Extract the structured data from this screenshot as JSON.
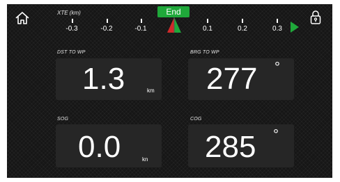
{
  "header": {
    "xte_label": "XTE (km)",
    "end_label": "End",
    "scale_ticks": [
      "-0.3",
      "-0.2",
      "-0.1",
      "0.1",
      "0.2",
      "0.3"
    ]
  },
  "icons": {
    "home": "home-icon",
    "lock": "padlock-icon",
    "boat": "boat-marker-icon",
    "direction": "play-arrow-icon"
  },
  "colors": {
    "accent_green": "#1fa83a",
    "marker_red": "#d12a2a",
    "background": "#161616",
    "panel": "#262626"
  },
  "panels": {
    "dst": {
      "label": "DST TO WP",
      "value": "1.3",
      "unit": "km"
    },
    "brg": {
      "label": "BRG TO WP",
      "value": "277",
      "unit": "°"
    },
    "sog": {
      "label": "SOG",
      "value": "0.0",
      "unit": "kn"
    },
    "cog": {
      "label": "COG",
      "value": "285",
      "unit": "°"
    }
  }
}
